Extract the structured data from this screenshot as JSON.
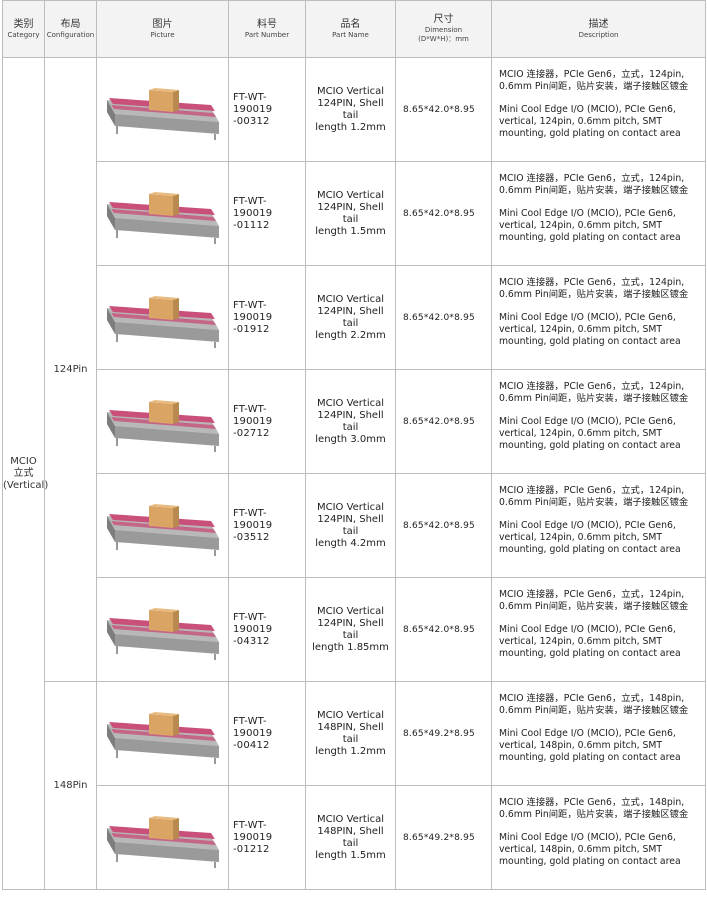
{
  "header": {
    "category_zh": "类别",
    "category_en": "Category",
    "configuration_zh": "布局",
    "configuration_en": "Configuration",
    "picture_zh": "图片",
    "picture_en": "Picture",
    "part_number_zh": "料号",
    "part_number_en": "Part Number",
    "part_name_zh": "品名",
    "part_name_en": "Part Name",
    "dimension_zh": "尺寸",
    "dimension_en": "Dimension",
    "dimension_unit": "(D*W*H)：mm",
    "description_zh": "描述",
    "description_en": "Description"
  },
  "category": {
    "line1": "MCIO",
    "line2": "立式",
    "line3": "(Vertical)"
  },
  "groups": [
    {
      "label": "124Pin"
    },
    {
      "label": "148Pin"
    }
  ],
  "rows": [
    {
      "pn1": "FT-WT-190019",
      "pn2": "-00312",
      "name1": "MCIO Vertical",
      "name2": "124PIN, Shell tail",
      "name3": "length 1.2mm",
      "dim": "8.65*42.0*8.95",
      "zh": "MCIO 连接器，PCIe Gen6，立式，124pin, 0.6mm Pin间距，贴片安装，端子接触区镀金",
      "en": "Mini Cool Edge I/O (MCIO), PCIe Gen6, vertical, 124pin, 0.6mm pitch, SMT mounting, gold plating on contact area"
    },
    {
      "pn1": "FT-WT-190019",
      "pn2": "-01112",
      "name1": "MCIO Vertical",
      "name2": "124PIN, Shell tail",
      "name3": "length 1.5mm",
      "dim": "8.65*42.0*8.95",
      "zh": "MCIO 连接器，PCIe Gen6，立式，124pin, 0.6mm Pin间距，贴片安装，端子接触区镀金",
      "en": "Mini Cool Edge I/O (MCIO), PCIe Gen6, vertical, 124pin, 0.6mm pitch, SMT mounting, gold plating on contact area"
    },
    {
      "pn1": "FT-WT-190019",
      "pn2": "-01912",
      "name1": "MCIO Vertical",
      "name2": "124PIN, Shell tail",
      "name3": "length 2.2mm",
      "dim": "8.65*42.0*8.95",
      "zh": "MCIO 连接器，PCIe Gen6，立式，124pin, 0.6mm Pin间距，贴片安装，端子接触区镀金",
      "en": "Mini Cool Edge I/O (MCIO), PCIe Gen6, vertical, 124pin, 0.6mm pitch, SMT mounting, gold plating on contact area"
    },
    {
      "pn1": "FT-WT-190019",
      "pn2": "-02712",
      "name1": "MCIO Vertical",
      "name2": "124PIN, Shell tail",
      "name3": "length 3.0mm",
      "dim": "8.65*42.0*8.95",
      "zh": "MCIO 连接器，PCIe Gen6，立式，124pin, 0.6mm Pin间距，贴片安装，端子接触区镀金",
      "en": "Mini Cool Edge I/O (MCIO), PCIe Gen6, vertical, 124pin, 0.6mm pitch, SMT mounting, gold plating on contact area"
    },
    {
      "pn1": "FT-WT-190019",
      "pn2": "-03512",
      "name1": "MCIO Vertical",
      "name2": "124PIN, Shell tail",
      "name3": "length 4.2mm",
      "dim": "8.65*42.0*8.95",
      "zh": "MCIO 连接器，PCIe Gen6，立式，124pin, 0.6mm Pin间距，贴片安装，端子接触区镀金",
      "en": "Mini Cool Edge I/O (MCIO), PCIe Gen6, vertical, 124pin, 0.6mm pitch, SMT mounting, gold plating on contact area"
    },
    {
      "pn1": "FT-WT-190019",
      "pn2": "-04312",
      "name1": "MCIO Vertical",
      "name2": "124PIN, Shell tail",
      "name3": "length 1.85mm",
      "dim": "8.65*42.0*8.95",
      "zh": "MCIO 连接器，PCIe Gen6，立式，124pin, 0.6mm Pin间距，贴片安装，端子接触区镀金",
      "en": "Mini Cool Edge I/O (MCIO), PCIe Gen6, vertical, 124pin, 0.6mm pitch, SMT mounting, gold plating on contact area"
    },
    {
      "pn1": "FT-WT-190019",
      "pn2": "-00412",
      "name1": "MCIO Vertical",
      "name2": "148PIN, Shell tail",
      "name3": "length 1.2mm",
      "dim": "8.65*49.2*8.95",
      "zh": "MCIO 连接器，PCIe Gen6，立式，148pin, 0.6mm Pin间距，贴片安装，端子接触区镀金",
      "en": "Mini Cool Edge I/O (MCIO), PCIe Gen6, vertical, 148pin, 0.6mm pitch, SMT mounting, gold plating on contact area"
    },
    {
      "pn1": "FT-WT-190019",
      "pn2": "-01212",
      "name1": "MCIO Vertical",
      "name2": "148PIN, Shell tail",
      "name3": "length 1.5mm",
      "dim": "8.65*49.2*8.95",
      "zh": "MCIO 连接器，PCIe Gen6，立式，148pin, 0.6mm Pin间距，贴片安装，端子接触区镀金",
      "en": "Mini Cool Edge I/O (MCIO), PCIe Gen6, vertical, 148pin, 0.6mm pitch, SMT mounting, gold plating on contact area"
    }
  ],
  "colors": {
    "housing": "#9a9a9a",
    "pins": "#c8507a",
    "cap": "#d9a464",
    "border": "#bdbdbd"
  }
}
